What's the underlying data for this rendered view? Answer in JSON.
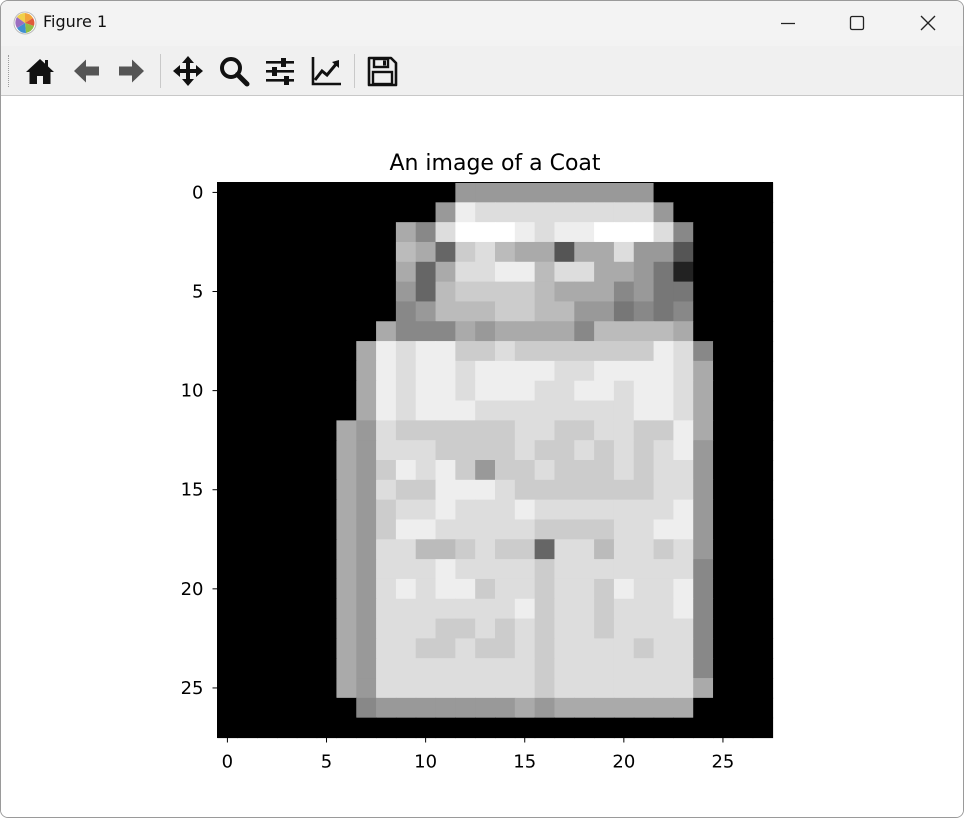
{
  "window": {
    "title": "Figure 1",
    "icon": "matplotlib-logo-icon",
    "controls": [
      "minimize-icon",
      "maximize-icon",
      "close-icon"
    ]
  },
  "toolbar": {
    "buttons": [
      {
        "name": "home-icon",
        "tooltip": "Reset original view"
      },
      {
        "name": "back-arrow-icon",
        "tooltip": "Back to previous view"
      },
      {
        "name": "forward-arrow-icon",
        "tooltip": "Forward to next view"
      },
      {
        "name": "pan-move-icon",
        "tooltip": "Pan axes"
      },
      {
        "name": "zoom-magnifier-icon",
        "tooltip": "Zoom to rectangle"
      },
      {
        "name": "subplots-sliders-icon",
        "tooltip": "Configure subplots"
      },
      {
        "name": "edit-axis-icon",
        "tooltip": "Edit axis"
      },
      {
        "name": "save-floppy-icon",
        "tooltip": "Save the figure"
      }
    ]
  },
  "chart_data": {
    "type": "heatmap",
    "title": "An image of a Coat",
    "colormap": "gray",
    "xlim": [
      -0.5,
      27.5
    ],
    "ylim": [
      27.5,
      -0.5
    ],
    "x_ticks": [
      0,
      5,
      10,
      15,
      20,
      25
    ],
    "y_ticks": [
      0,
      5,
      10,
      15,
      20,
      25
    ],
    "xlabel": "",
    "ylabel": "",
    "grid": false,
    "values": [
      "0000000000009999999999000000",
      "000000000009EDDDDDDDDD900000",
      "000000000A8DFFFEDEEFFFD80000",
      "000000000BA6CDBAA5AAD9950000",
      "000000000A6ADDEEBDDAA9720000",
      "00000000096BCCCCBAAA89770000",
      "00000000089BBBCCBB9978780000",
      "00000000A888A9AAAA8BBBBA0000",
      "0000000AEDEECCDCCCCCCCED8000",
      "0000000AEDEEDEEEEDDEEEEDA000",
      "0000000AEDEEDEEEDDEEDEEDA000",
      "0000000AEDEEEDDDDDDDDEEDA000",
      "000000A9DCCCCCCDDCCDDCCEA000",
      "000000A9DDDCCCCDCCDCDCDE9000",
      "000000A9CEDEC9CCDCCCDCDD9000",
      "000000A9DCCEEEDCCCCCCCDD9000",
      "000000A9CDDEDDDEDDDDDDDE9000",
      "000000A9CEEDDDDDCCCCDDEE9000",
      "000000A9DDBBCDCC6DDBDDCD9000",
      "000000A9DDDEDDDDCDDDDDDD8000",
      "000000A9DEDEECDDCDDCEDDE8000",
      "000000A9DDDDDDDECDDCDDDE8000",
      "000000A9DDDCCDCDCDDCDDDD8000",
      "000000A9DDCCDCCDCDDDDCDD8000",
      "000000A9DDDDDDDDCDDDDDDD8000",
      "000000A9DDDDDDDDCDDDDDDDA000",
      "000000089999999A9AAAAAAA0000",
      "0000000000000000000000000000"
    ]
  }
}
